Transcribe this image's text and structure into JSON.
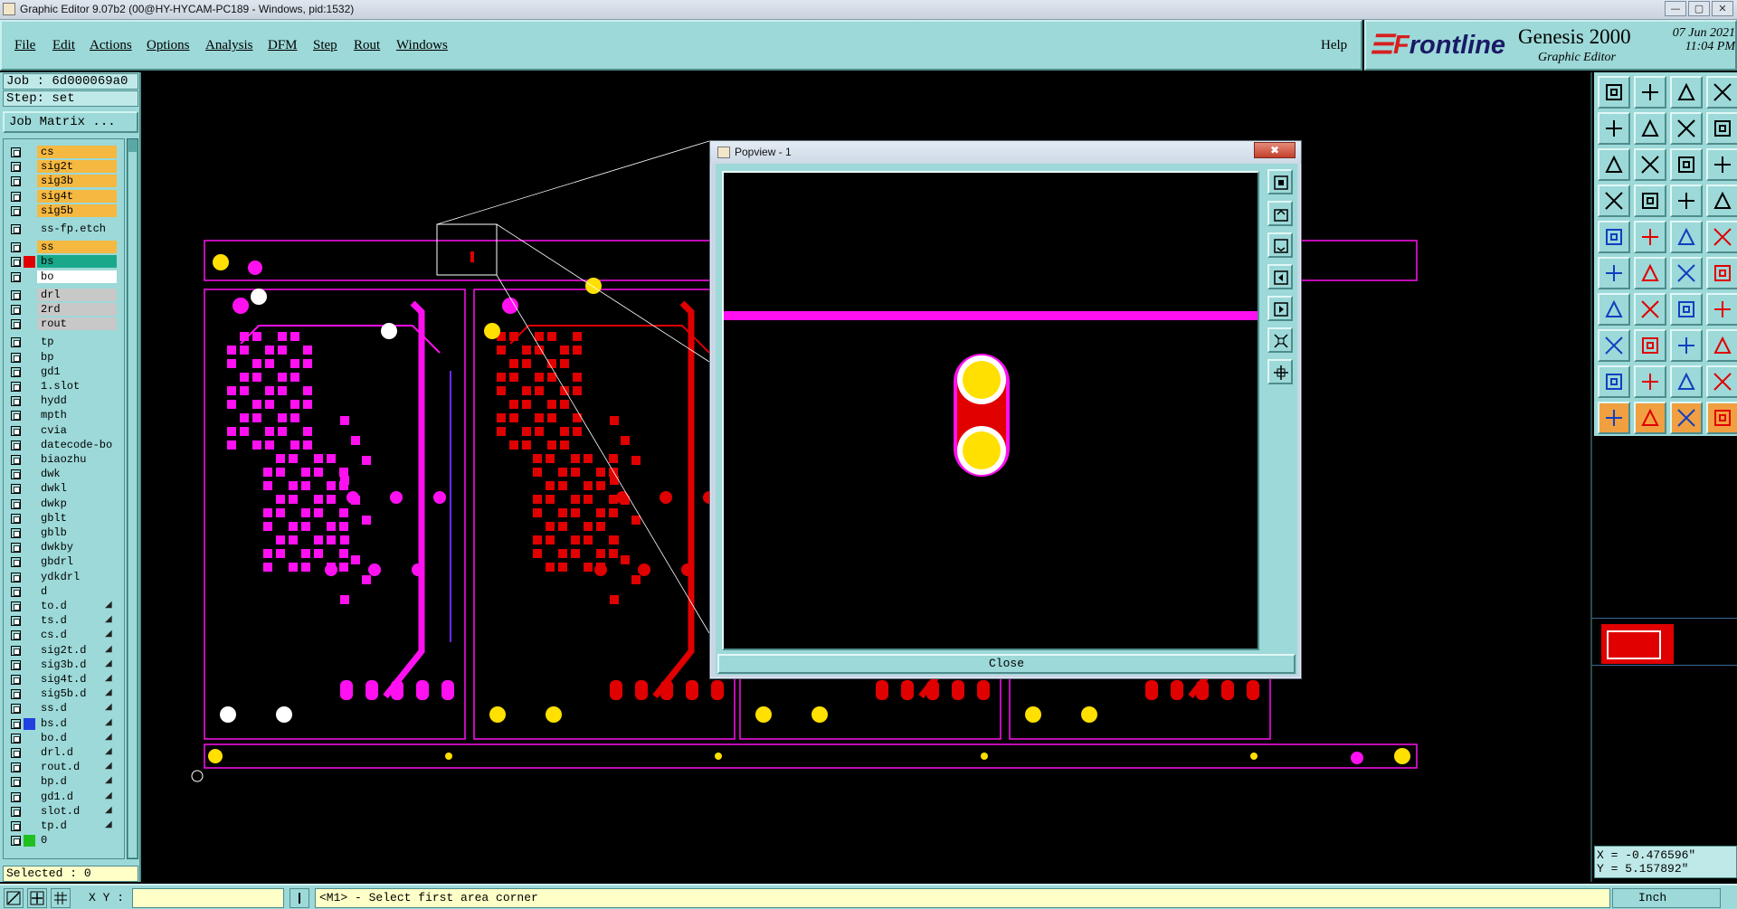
{
  "window": {
    "title": "Graphic Editor 9.07b2 (00@HY-HYCAM-PC189 - Windows, pid:1532)"
  },
  "menu": {
    "items": [
      "File",
      "Edit",
      "Actions",
      "Options",
      "Analysis",
      "DFM",
      "Step",
      "Rout",
      "Windows"
    ],
    "help": "Help"
  },
  "branding": {
    "company_a": "☰F",
    "company_b": "rontline",
    "product": "Genesis 2000",
    "subtitle": "Graphic Editor",
    "date": "07 Jun 2021",
    "time": "11:04 PM"
  },
  "job": {
    "job_label": "Job : 6d000069a0",
    "step_label": "Step: set",
    "matrix_button": "Job Matrix ..."
  },
  "layers": [
    {
      "name": "cs",
      "color": "#f5b840",
      "swatch": ""
    },
    {
      "name": "sig2t",
      "color": "#f5b840",
      "swatch": ""
    },
    {
      "name": "sig3b",
      "color": "#f5b840",
      "swatch": ""
    },
    {
      "name": "sig4t",
      "color": "#f5b840",
      "swatch": ""
    },
    {
      "name": "sig5b",
      "color": "#f5b840",
      "swatch": ""
    },
    {
      "name": "ss-fp.etch",
      "color": "#9cd9d8",
      "swatch": ""
    },
    {
      "name": "ss",
      "color": "#f5b840",
      "swatch": ""
    },
    {
      "name": "bs",
      "color": "#1aa88a",
      "swatch": "#e00000"
    },
    {
      "name": "bo",
      "color": "#ffffff",
      "swatch": ""
    },
    {
      "name": "drl",
      "color": "#c8c8c8",
      "swatch": ""
    },
    {
      "name": "2rd",
      "color": "#c8c8c8",
      "swatch": ""
    },
    {
      "name": "rout",
      "color": "#c8c8c8",
      "swatch": ""
    },
    {
      "name": "tp",
      "color": "#9cd9d8",
      "swatch": ""
    },
    {
      "name": "bp",
      "color": "#9cd9d8",
      "swatch": ""
    },
    {
      "name": "gd1",
      "color": "#9cd9d8",
      "swatch": ""
    },
    {
      "name": "1.slot",
      "color": "#9cd9d8",
      "swatch": ""
    },
    {
      "name": "hydd",
      "color": "#9cd9d8",
      "swatch": ""
    },
    {
      "name": "mpth",
      "color": "#9cd9d8",
      "swatch": ""
    },
    {
      "name": "cvia",
      "color": "#9cd9d8",
      "swatch": ""
    },
    {
      "name": "datecode-bo",
      "color": "#9cd9d8",
      "swatch": ""
    },
    {
      "name": "biaozhu",
      "color": "#9cd9d8",
      "swatch": ""
    },
    {
      "name": "dwk",
      "color": "#9cd9d8",
      "swatch": ""
    },
    {
      "name": "dwkl",
      "color": "#9cd9d8",
      "swatch": ""
    },
    {
      "name": "dwkp",
      "color": "#9cd9d8",
      "swatch": ""
    },
    {
      "name": "gblt",
      "color": "#9cd9d8",
      "swatch": ""
    },
    {
      "name": "gblb",
      "color": "#9cd9d8",
      "swatch": ""
    },
    {
      "name": "dwkby",
      "color": "#9cd9d8",
      "swatch": ""
    },
    {
      "name": "gbdrl",
      "color": "#9cd9d8",
      "swatch": ""
    },
    {
      "name": "ydkdrl",
      "color": "#9cd9d8",
      "swatch": ""
    },
    {
      "name": "d",
      "color": "#9cd9d8",
      "swatch": ""
    },
    {
      "name": "to.d",
      "color": "#9cd9d8",
      "swatch": ""
    },
    {
      "name": "ts.d",
      "color": "#9cd9d8",
      "swatch": ""
    },
    {
      "name": "cs.d",
      "color": "#9cd9d8",
      "swatch": ""
    },
    {
      "name": "sig2t.d",
      "color": "#9cd9d8",
      "swatch": ""
    },
    {
      "name": "sig3b.d",
      "color": "#9cd9d8",
      "swatch": ""
    },
    {
      "name": "sig4t.d",
      "color": "#9cd9d8",
      "swatch": ""
    },
    {
      "name": "sig5b.d",
      "color": "#9cd9d8",
      "swatch": ""
    },
    {
      "name": "ss.d",
      "color": "#9cd9d8",
      "swatch": ""
    },
    {
      "name": "bs.d",
      "color": "#9cd9d8",
      "swatch": "#2040e0"
    },
    {
      "name": "bo.d",
      "color": "#9cd9d8",
      "swatch": ""
    },
    {
      "name": "drl.d",
      "color": "#9cd9d8",
      "swatch": ""
    },
    {
      "name": "rout.d",
      "color": "#9cd9d8",
      "swatch": ""
    },
    {
      "name": "bp.d",
      "color": "#9cd9d8",
      "swatch": ""
    },
    {
      "name": "gd1.d",
      "color": "#9cd9d8",
      "swatch": ""
    },
    {
      "name": "slot.d",
      "color": "#9cd9d8",
      "swatch": ""
    },
    {
      "name": "tp.d",
      "color": "#9cd9d8",
      "swatch": ""
    },
    {
      "name": "0",
      "color": "#9cd9d8",
      "swatch": "#20c020"
    }
  ],
  "selected_text": "Selected : 0",
  "popup": {
    "title": "Popview - 1",
    "close_x": "✖",
    "close_button": "Close"
  },
  "coordinates": {
    "x": "X = -0.476596\"",
    "y": "Y = 5.157892\""
  },
  "status": {
    "xy_label": "X Y :",
    "xy_value": "",
    "message": "<M1> - Select first area corner",
    "unit": "Inch"
  },
  "colors": {
    "panel": "#9cd9d8",
    "active_layer": "#e00000",
    "second_layer": "#ff10f0",
    "pad": "#ffe000"
  }
}
